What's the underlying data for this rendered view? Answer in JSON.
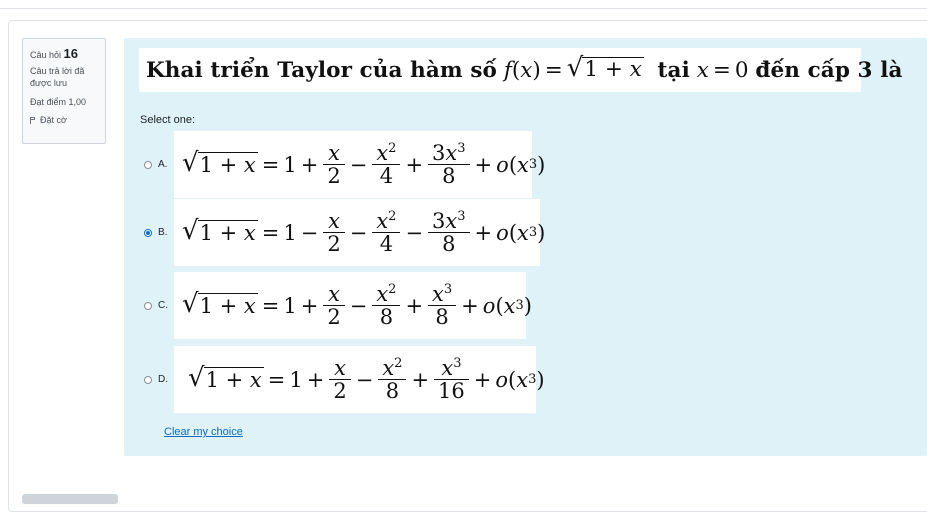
{
  "info": {
    "question_label": "Câu hỏi",
    "question_number": "16",
    "state": "Câu trả lời đã được lưu",
    "grade": "Đạt điểm 1,00",
    "flag_label": "Đặt cờ"
  },
  "question": {
    "prefix": "Khai triển Taylor của hàm số",
    "middle": "tại",
    "suffix": "đến cấp 3 là"
  },
  "prompt": "Select one:",
  "options": [
    {
      "letter": "A.",
      "selected": false
    },
    {
      "letter": "B.",
      "selected": true
    },
    {
      "letter": "C.",
      "selected": false
    },
    {
      "letter": "D.",
      "selected": false
    }
  ],
  "clear_label": "Clear my choice",
  "colors": {
    "accent": "#0f6cbf",
    "content_bg": "#def2f8"
  }
}
